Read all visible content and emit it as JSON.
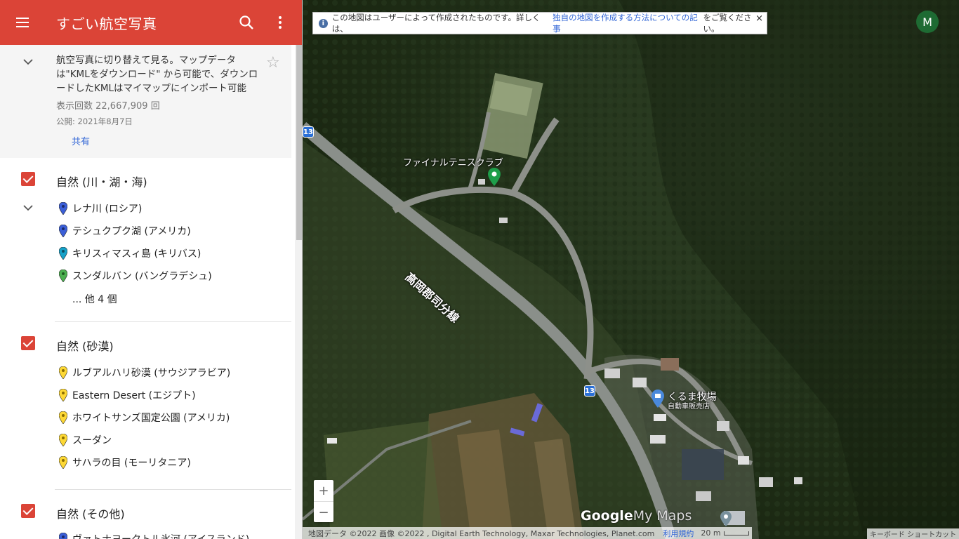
{
  "header": {
    "title": "すごい航空写真"
  },
  "description": {
    "text": "航空写真に切り替えて見る。マップデータは\"KMLをダウンロード\" から可能で、ダウンロードしたKMLはマイマップにインポート可能",
    "views": "表示回数 22,667,909 回",
    "published": "公開: 2021年8月7日",
    "share": "共有"
  },
  "layers": [
    {
      "title": "自然 (川・湖・海)",
      "checked": true,
      "items": [
        {
          "label": "レナ川 (ロシア)",
          "pin_color": "#3b5fd8"
        },
        {
          "label": "テシュクプク湖 (アメリカ)",
          "pin_color": "#3b5fd8"
        },
        {
          "label": "キリスィマスィ島 (キリバス)",
          "pin_color": "#17a1c8"
        },
        {
          "label": "スンダルバン (バングラデシュ)",
          "pin_color": "#4caf50"
        }
      ],
      "more": "... 他 4 個"
    },
    {
      "title": "自然 (砂漠)",
      "checked": true,
      "items": [
        {
          "label": "ルブアルハリ砂漠 (サウジアラビア)",
          "pin_color": "#fdd835"
        },
        {
          "label": "Eastern Desert (エジプト)",
          "pin_color": "#fdd835"
        },
        {
          "label": "ホワイトサンズ国定公園 (アメリカ)",
          "pin_color": "#fdd835"
        },
        {
          "label": "スーダン",
          "pin_color": "#fdd835"
        },
        {
          "label": "サハラの目 (モーリタニア)",
          "pin_color": "#fdd835"
        }
      ]
    },
    {
      "title": "自然 (その他)",
      "checked": true,
      "items": [
        {
          "label": "ヴァトナヨークトル氷河 (アイスランド)",
          "pin_color": "#3b5fd8"
        }
      ]
    }
  ],
  "map": {
    "notice_prefix": "この地図はユーザーによって作成されたものです。詳しくは、",
    "notice_link": "独自の地図を作成する方法についての記事",
    "notice_suffix": "をご覧ください。",
    "close": "×",
    "avatar_letter": "M",
    "road_name": "高岡郡司分線",
    "route_number": "13",
    "place_tennis": "ファイナルテニスクラブ",
    "place_farm": "くるま牧場",
    "place_farm_sub": "自動車販売店",
    "zoom_in": "+",
    "zoom_out": "−",
    "logo_google": "Google",
    "logo_mymaps": "My Maps",
    "footer_attribution": "地図データ ©2022 画像 ©2022 , Digital Earth Technology, Maxar Technologies, Planet.com",
    "footer_terms": "利用規約",
    "footer_scale": "20 m",
    "keyboard_shortcut": "キーボード ショートカット"
  },
  "colors": {
    "accent": "#db4437",
    "link": "#3367d6"
  }
}
